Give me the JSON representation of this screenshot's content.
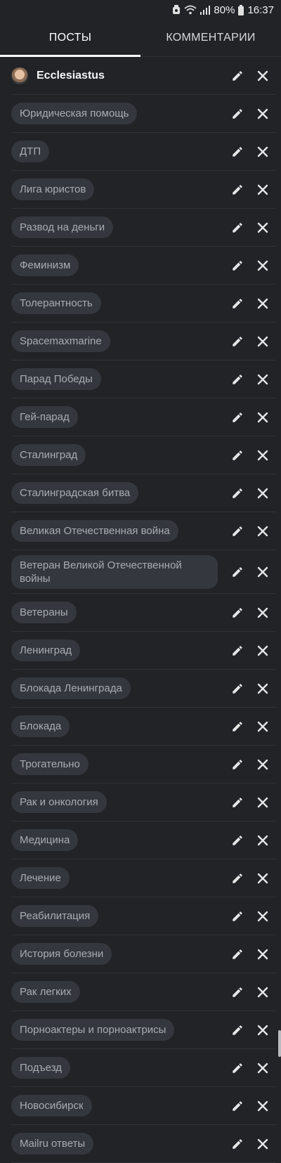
{
  "status_bar": {
    "battery_percent": "80%",
    "time": "16:37"
  },
  "tabs": [
    {
      "label": "ПОСТЫ",
      "active": true
    },
    {
      "label": "КОММЕНТАРИИ",
      "active": false
    }
  ],
  "user": {
    "name": "Ecclesiastus"
  },
  "tags": [
    "Юридическая помощь",
    "ДТП",
    "Лига юристов",
    "Развод на деньги",
    "Феминизм",
    "Толерантность",
    "Spacemaxmarine",
    "Парад Победы",
    "Гей-парад",
    "Сталинград",
    "Сталинградская битва",
    "Великая Отечественная война",
    "Ветеран Великой Отечественной войны",
    "Ветераны",
    "Ленинград",
    "Блокада Ленинграда",
    "Блокада",
    "Трогательно",
    "Рак и онкология",
    "Медицина",
    "Лечение",
    "Реабилитация",
    "История болезни",
    "Рак легких",
    "Порноактеры и порноактрисы",
    "Подъезд",
    "Новосибирск",
    "Mailru ответы"
  ],
  "colors": {
    "background": "#212327",
    "chip_bg": "#34373d",
    "chip_text": "#a9adb3",
    "divider": "#2f3237",
    "tab_indicator": "#ffffff"
  }
}
